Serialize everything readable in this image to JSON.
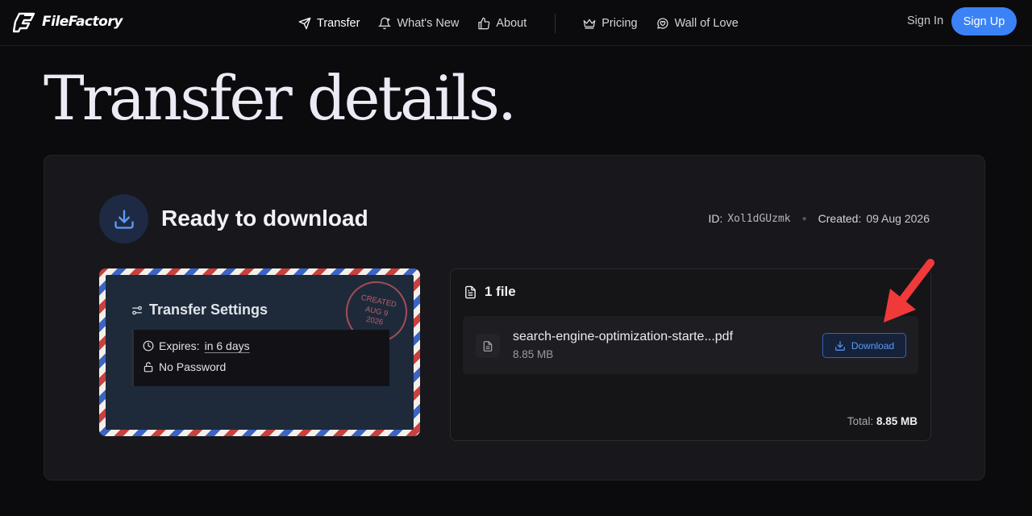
{
  "brand": {
    "name": "FileFactory",
    "accent": "#3b82f6"
  },
  "nav": {
    "items": [
      {
        "label": "Transfer",
        "icon": "send-icon"
      },
      {
        "label": "What's New",
        "icon": "bell-icon"
      },
      {
        "label": "About",
        "icon": "thumbs-up-icon"
      },
      {
        "label": "Pricing",
        "icon": "crown-icon"
      },
      {
        "label": "Wall of Love",
        "icon": "chat-heart-icon"
      }
    ],
    "sign_in": "Sign In",
    "sign_up": "Sign Up"
  },
  "page": {
    "title": "Transfer details."
  },
  "transfer": {
    "status": "Ready to download",
    "id_label": "ID:",
    "id": "Xol1dGUzmk",
    "created_label": "Created:",
    "created": "09 Aug 2026"
  },
  "settings": {
    "title": "Transfer Settings",
    "expires_label": "Expires:",
    "expires_value": "in 6 days",
    "password": "No Password",
    "stamp": [
      "CREATED",
      "AUG 9",
      "2026"
    ]
  },
  "files": {
    "count_label": "1 file",
    "items": [
      {
        "name": "search-engine-optimization-starte...pdf",
        "size": "8.85 MB",
        "action": "Download"
      }
    ],
    "total_label": "Total:",
    "total": "8.85 MB"
  }
}
